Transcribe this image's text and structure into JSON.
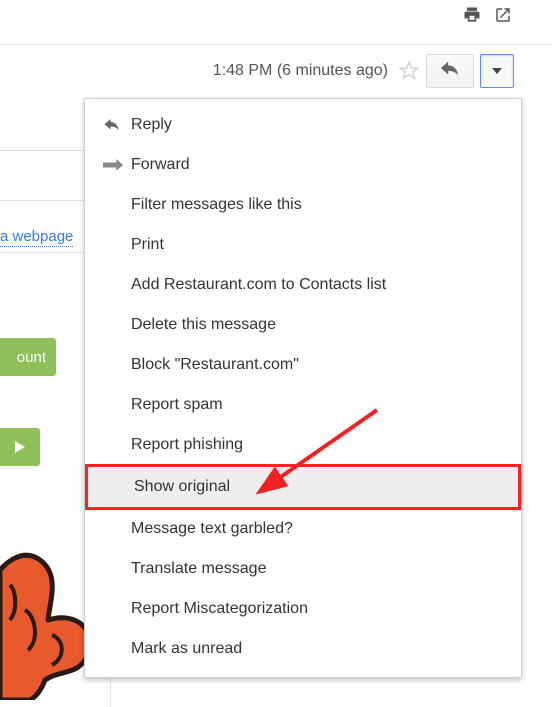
{
  "timestamp": "1:48 PM (6 minutes ago)",
  "menu": {
    "items": [
      "Reply",
      "Forward",
      "Filter messages like this",
      "Print",
      "Add Restaurant.com to Contacts list",
      "Delete this message",
      "Block \"Restaurant.com\"",
      "Report spam",
      "Report phishing",
      "Show original",
      "Message text garbled?",
      "Translate message",
      "Report Miscategorization",
      "Mark as unread"
    ],
    "highlighted_index": 9
  },
  "background": {
    "link_text": "a webpage",
    "green_button_text": "ount"
  }
}
